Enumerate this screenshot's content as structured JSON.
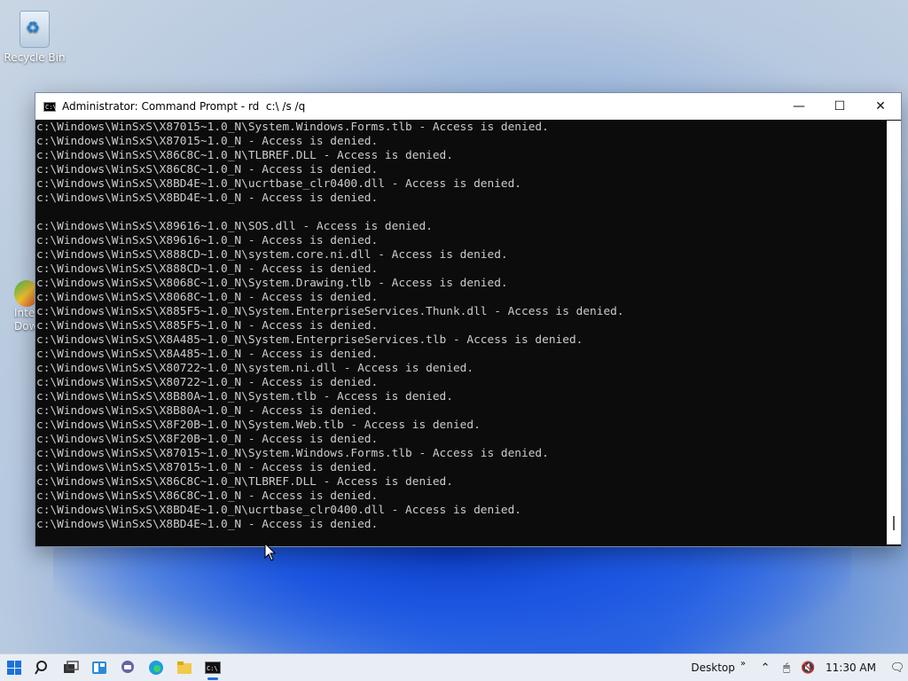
{
  "desktop": {
    "recycle_bin_label": "Recycle Bin",
    "partial_icon_label_1": "Inte",
    "partial_icon_label_2": "Dow"
  },
  "window": {
    "title": "Administrator: Command Prompt - rd  c:\\ /s /q",
    "minimize": "—",
    "maximize": "☐",
    "close": "✕"
  },
  "console": {
    "lines": [
      "c:\\Windows\\WinSxS\\X87015~1.0_N\\System.Windows.Forms.tlb - Access is denied.",
      "c:\\Windows\\WinSxS\\X87015~1.0_N - Access is denied.",
      "c:\\Windows\\WinSxS\\X86C8C~1.0_N\\TLBREF.DLL - Access is denied.",
      "c:\\Windows\\WinSxS\\X86C8C~1.0_N - Access is denied.",
      "c:\\Windows\\WinSxS\\X8BD4E~1.0_N\\ucrtbase_clr0400.dll - Access is denied.",
      "c:\\Windows\\WinSxS\\X8BD4E~1.0_N - Access is denied.",
      "",
      "c:\\Windows\\WinSxS\\X89616~1.0_N\\SOS.dll - Access is denied.",
      "c:\\Windows\\WinSxS\\X89616~1.0_N - Access is denied.",
      "c:\\Windows\\WinSxS\\X888CD~1.0_N\\system.core.ni.dll - Access is denied.",
      "c:\\Windows\\WinSxS\\X888CD~1.0_N - Access is denied.",
      "c:\\Windows\\WinSxS\\X8068C~1.0_N\\System.Drawing.tlb - Access is denied.",
      "c:\\Windows\\WinSxS\\X8068C~1.0_N - Access is denied.",
      "c:\\Windows\\WinSxS\\X885F5~1.0_N\\System.EnterpriseServices.Thunk.dll - Access is denied.",
      "c:\\Windows\\WinSxS\\X885F5~1.0_N - Access is denied.",
      "c:\\Windows\\WinSxS\\X8A485~1.0_N\\System.EnterpriseServices.tlb - Access is denied.",
      "c:\\Windows\\WinSxS\\X8A485~1.0_N - Access is denied.",
      "c:\\Windows\\WinSxS\\X80722~1.0_N\\system.ni.dll - Access is denied.",
      "c:\\Windows\\WinSxS\\X80722~1.0_N - Access is denied.",
      "c:\\Windows\\WinSxS\\X8B80A~1.0_N\\System.tlb - Access is denied.",
      "c:\\Windows\\WinSxS\\X8B80A~1.0_N - Access is denied.",
      "c:\\Windows\\WinSxS\\X8F20B~1.0_N\\System.Web.tlb - Access is denied.",
      "c:\\Windows\\WinSxS\\X8F20B~1.0_N - Access is denied.",
      "c:\\Windows\\WinSxS\\X87015~1.0_N\\System.Windows.Forms.tlb - Access is denied.",
      "c:\\Windows\\WinSxS\\X87015~1.0_N - Access is denied.",
      "c:\\Windows\\WinSxS\\X86C8C~1.0_N\\TLBREF.DLL - Access is denied.",
      "c:\\Windows\\WinSxS\\X86C8C~1.0_N - Access is denied.",
      "c:\\Windows\\WinSxS\\X8BD4E~1.0_N\\ucrtbase_clr0400.dll - Access is denied.",
      "c:\\Windows\\WinSxS\\X8BD4E~1.0_N - Access is denied."
    ]
  },
  "taskbar": {
    "desktop_label": "Desktop",
    "overflow_glyph": "»",
    "clock": "11:30 AM",
    "icons": [
      "start-icon",
      "search-icon",
      "task-view-icon",
      "widgets-icon",
      "chat-icon",
      "edge-icon",
      "file-explorer-icon",
      "command-prompt-icon"
    ]
  }
}
